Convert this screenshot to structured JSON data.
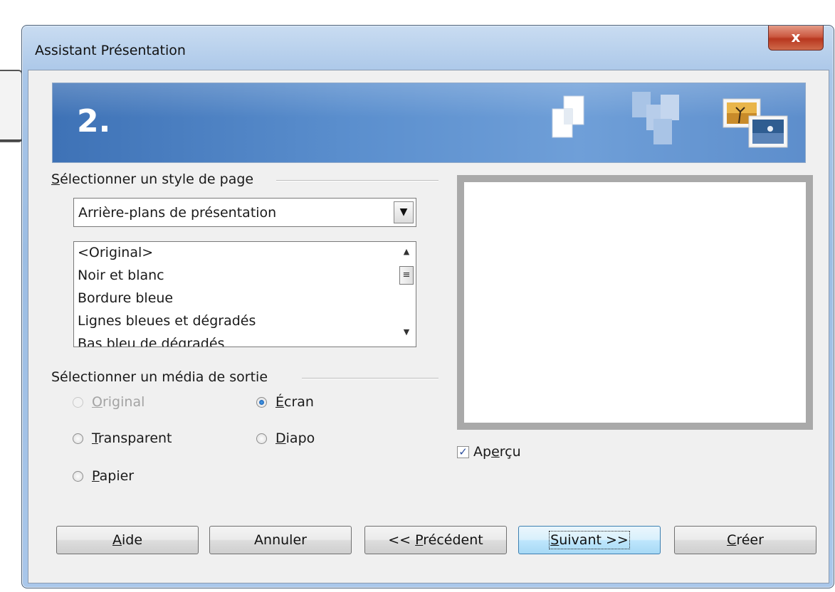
{
  "window": {
    "title": "Assistant Présentation",
    "close_label": "x"
  },
  "banner": {
    "step": "2."
  },
  "page_style": {
    "group_label_mnemonic": "S",
    "group_label_rest": "électionner un style de page",
    "selected_category": "Arrière-plans de présentation",
    "dropdown_icon": "triangle-down",
    "items": [
      "<Original>",
      "Noir et blanc",
      "Bordure bleue",
      "Lignes bleues et dégradés",
      "Bas bleu de dégradés"
    ]
  },
  "output_media": {
    "group_label": "Sélectionner un média de sortie",
    "options": [
      {
        "mnemonic": "O",
        "rest": "riginal",
        "checked": false,
        "disabled": true
      },
      {
        "mnemonic": "É",
        "rest": "cran",
        "checked": true,
        "disabled": false
      },
      {
        "mnemonic": "T",
        "rest": "ransparent",
        "checked": false,
        "disabled": false
      },
      {
        "mnemonic": "D",
        "rest": "iapo",
        "checked": false,
        "disabled": false
      },
      {
        "mnemonic": "P",
        "rest": "apier",
        "checked": false,
        "disabled": false
      }
    ]
  },
  "preview": {
    "checkbox_pre": "Ap",
    "checkbox_mnemonic": "e",
    "checkbox_post": "rçu",
    "checked": true
  },
  "buttons": {
    "help": {
      "mnemonic": "A",
      "rest": "ide"
    },
    "cancel": {
      "label": "Annuler"
    },
    "previous": {
      "pre": "<< ",
      "mnemonic": "P",
      "rest": "récédent"
    },
    "next": {
      "mnemonic": "S",
      "rest": "uivant >>"
    },
    "create": {
      "mnemonic": "C",
      "rest": "réer"
    }
  },
  "colors": {
    "banner": "#4f86c9",
    "preview_border": "#a9a9a9",
    "radio_selected": "#1560c0"
  }
}
